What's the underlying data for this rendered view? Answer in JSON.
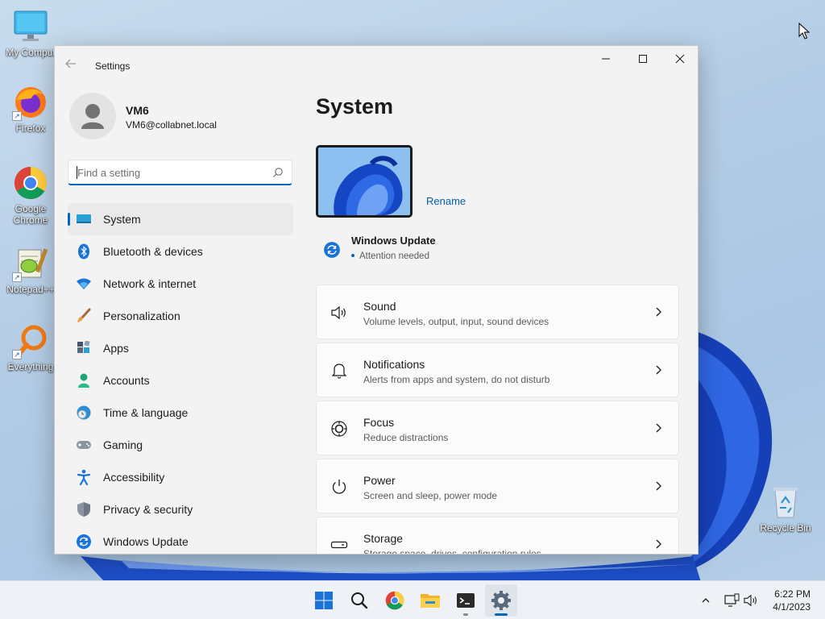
{
  "desktop": {
    "icons": [
      {
        "name": "my-computer",
        "label": "My Comput"
      },
      {
        "name": "firefox",
        "label": "Firefox"
      },
      {
        "name": "google-chrome",
        "label": "Google Chrome"
      },
      {
        "name": "notepadpp",
        "label": "Notepad++"
      },
      {
        "name": "everything",
        "label": "Everything"
      },
      {
        "name": "recycle-bin",
        "label": "Recycle Bin"
      }
    ]
  },
  "window": {
    "title": "Settings",
    "controls": {
      "minimize": "minimize-icon",
      "maximize": "maximize-icon",
      "close": "close-icon"
    }
  },
  "profile": {
    "name": "VM6",
    "email": "VM6@collabnet.local"
  },
  "search": {
    "placeholder": "Find a setting"
  },
  "sidebar": {
    "items": [
      {
        "label": "System",
        "icon": "system-icon",
        "active": true
      },
      {
        "label": "Bluetooth & devices",
        "icon": "bluetooth-icon"
      },
      {
        "label": "Network & internet",
        "icon": "wifi-icon"
      },
      {
        "label": "Personalization",
        "icon": "brush-icon"
      },
      {
        "label": "Apps",
        "icon": "apps-icon"
      },
      {
        "label": "Accounts",
        "icon": "accounts-icon"
      },
      {
        "label": "Time & language",
        "icon": "time-language-icon"
      },
      {
        "label": "Gaming",
        "icon": "gamepad-icon"
      },
      {
        "label": "Accessibility",
        "icon": "accessibility-icon"
      },
      {
        "label": "Privacy & security",
        "icon": "shield-icon"
      },
      {
        "label": "Windows Update",
        "icon": "windows-update-icon"
      }
    ]
  },
  "main": {
    "title": "System",
    "rename_label": "Rename",
    "windows_update": {
      "title": "Windows Update",
      "status": "Attention needed"
    },
    "cards": [
      {
        "title": "Sound",
        "subtitle": "Volume levels, output, input, sound devices",
        "icon": "speaker-icon"
      },
      {
        "title": "Notifications",
        "subtitle": "Alerts from apps and system, do not disturb",
        "icon": "bell-icon"
      },
      {
        "title": "Focus",
        "subtitle": "Reduce distractions",
        "icon": "focus-icon"
      },
      {
        "title": "Power",
        "subtitle": "Screen and sleep, power mode",
        "icon": "power-icon"
      },
      {
        "title": "Storage",
        "subtitle": "Storage space, drives, configuration rules",
        "icon": "storage-icon"
      }
    ]
  },
  "taskbar": {
    "apps": [
      "start-icon",
      "search-icon",
      "chrome-icon",
      "file-explorer-icon",
      "terminal-icon",
      "settings-icon"
    ],
    "clock": {
      "time": "6:22 PM",
      "date": "4/1/2023"
    }
  },
  "colors": {
    "accent": "#0067c0",
    "window_bg": "#f3f3f3",
    "card_bg": "#fbfbfb",
    "link": "#005fb8"
  }
}
